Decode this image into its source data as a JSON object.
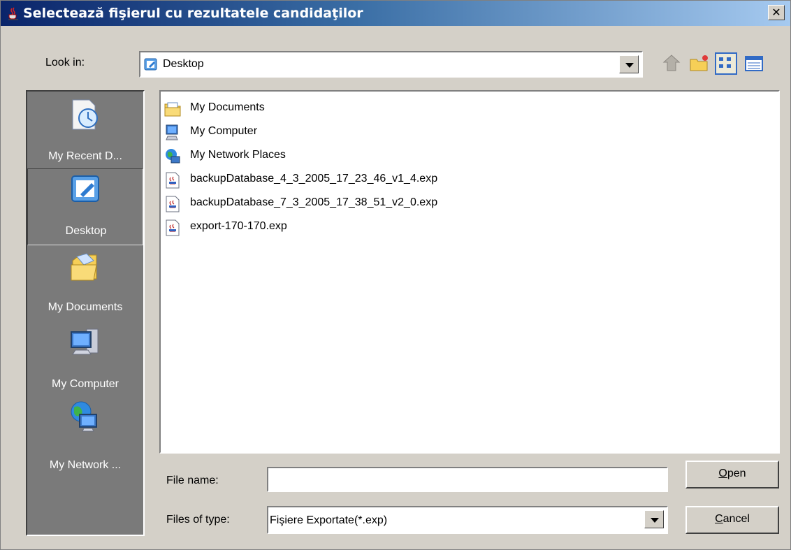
{
  "title": "Selectează fişierul cu rezultatele candidaţilor",
  "close_label": "✕",
  "look_in": {
    "label": "Look in:",
    "value": "Desktop"
  },
  "places": [
    {
      "label": "My Recent D...",
      "icon": "recent-documents-icon"
    },
    {
      "label": "Desktop",
      "icon": "desktop-icon",
      "selected": true
    },
    {
      "label": "My Documents",
      "icon": "my-documents-icon"
    },
    {
      "label": "My Computer",
      "icon": "my-computer-icon"
    },
    {
      "label": "My Network ...",
      "icon": "network-places-icon"
    }
  ],
  "files": [
    {
      "name": "My Documents",
      "icon": "folder-documents-icon"
    },
    {
      "name": "My Computer",
      "icon": "computer-icon"
    },
    {
      "name": "My Network Places",
      "icon": "network-icon"
    },
    {
      "name": "backupDatabase_4_3_2005_17_23_46_v1_4.exp",
      "icon": "java-file-icon"
    },
    {
      "name": "backupDatabase_7_3_2005_17_38_51_v2_0.exp",
      "icon": "java-file-icon"
    },
    {
      "name": "export-170-170.exp",
      "icon": "java-file-icon"
    }
  ],
  "file_name": {
    "label": "File name:",
    "value": ""
  },
  "files_of_type": {
    "label": "Files of type:",
    "value": "Fişiere Exportate(*.exp)"
  },
  "buttons": {
    "open_prefix": "O",
    "open_rest": "pen",
    "cancel_prefix": "C",
    "cancel_rest": "ancel"
  }
}
